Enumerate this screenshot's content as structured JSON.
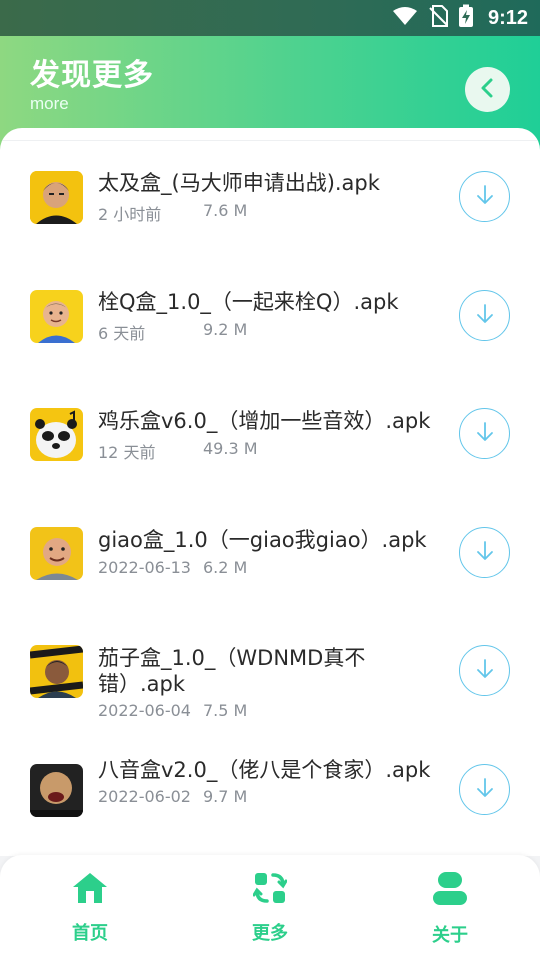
{
  "status_bar": {
    "time": "9:12",
    "icons": [
      "wifi-icon",
      "no-sim-icon",
      "battery-charging-icon"
    ]
  },
  "header": {
    "title": "发现更多",
    "subtitle": "more",
    "back_icon": "chevron-left-icon"
  },
  "files": [
    {
      "name": "太及盒_(马大师申请出战).apk",
      "time": "2 小时前",
      "size": "7.6 M",
      "download_icon": "arrow-down-icon"
    },
    {
      "name": "栓Q盒_1.0_（一起来栓Q）.apk",
      "time": "6 天前",
      "size": "9.2 M",
      "download_icon": "arrow-down-icon"
    },
    {
      "name": "鸡乐盒v6.0_（增加一些音效）.apk",
      "time": "12 天前",
      "size": "49.3 M",
      "download_icon": "arrow-down-icon"
    },
    {
      "name": "giao盒_1.0（一giao我giao）.apk",
      "time": "2022-06-13",
      "size": "6.2 M",
      "download_icon": "arrow-down-icon"
    },
    {
      "name": "茄子盒_1.0_（WDNMD真不错）.apk",
      "time": "2022-06-04",
      "size": "7.5 M",
      "download_icon": "arrow-down-icon"
    },
    {
      "name": "八音盒v2.0_（佬八是个食家）.apk",
      "time": "2022-06-02",
      "size": "9.7 M",
      "download_icon": "arrow-down-icon"
    }
  ],
  "bottom_nav": [
    {
      "label": "首页",
      "icon": "home-icon"
    },
    {
      "label": "更多",
      "icon": "refresh-icon"
    },
    {
      "label": "关于",
      "icon": "user-icon"
    }
  ],
  "colors": {
    "accent": "#2ccf8b",
    "header_gradient_start": "#8ed881",
    "header_gradient_end": "#1fcf97",
    "download_ring": "#63c6ea",
    "meta_text": "#8a8f96"
  }
}
